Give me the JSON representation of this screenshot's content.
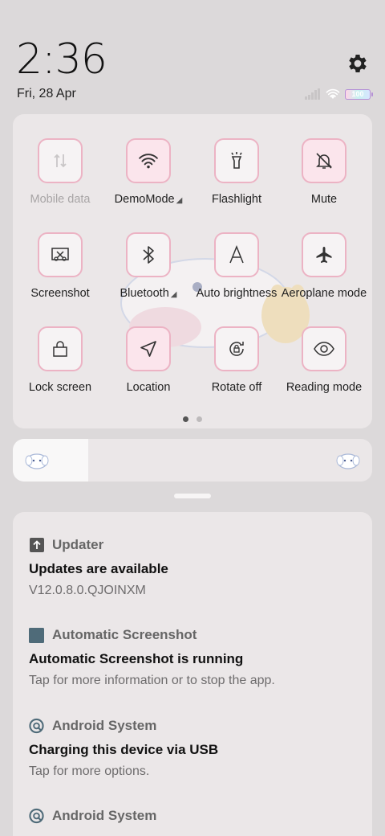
{
  "header": {
    "time": "2:36",
    "date": "Fri, 28 Apr",
    "battery": "100"
  },
  "quick_tiles": [
    {
      "label": "Mobile data",
      "icon": "mobile-data-icon",
      "active": false,
      "disabled": true,
      "has_arrow": false
    },
    {
      "label": "DemoMode",
      "icon": "wifi-icon",
      "active": true,
      "disabled": false,
      "has_arrow": true
    },
    {
      "label": "Flashlight",
      "icon": "flashlight-icon",
      "active": false,
      "disabled": false,
      "has_arrow": false
    },
    {
      "label": "Mute",
      "icon": "bell-off-icon",
      "active": true,
      "disabled": false,
      "has_arrow": false
    },
    {
      "label": "Screenshot",
      "icon": "screenshot-icon",
      "active": false,
      "disabled": false,
      "has_arrow": false
    },
    {
      "label": "Bluetooth",
      "icon": "bluetooth-icon",
      "active": false,
      "disabled": false,
      "has_arrow": true
    },
    {
      "label": "Auto brightness",
      "icon": "auto-brightness-icon",
      "active": false,
      "disabled": false,
      "has_arrow": false
    },
    {
      "label": "Aeroplane mode",
      "icon": "airplane-icon",
      "active": false,
      "disabled": false,
      "has_arrow": false
    },
    {
      "label": "Lock screen",
      "icon": "lock-icon",
      "active": false,
      "disabled": false,
      "has_arrow": false
    },
    {
      "label": "Location",
      "icon": "location-icon",
      "active": true,
      "disabled": false,
      "has_arrow": false
    },
    {
      "label": "Rotate off",
      "icon": "rotate-lock-icon",
      "active": false,
      "disabled": false,
      "has_arrow": false
    },
    {
      "label": "Reading mode",
      "icon": "eye-icon",
      "active": false,
      "disabled": false,
      "has_arrow": false
    }
  ],
  "pager": {
    "pages": 2,
    "current": 1
  },
  "brightness": {
    "level": 0.21
  },
  "notifications": [
    {
      "app": "Updater",
      "icon": "upload-arrow-icon",
      "title": "Updates are available",
      "body": "V12.0.8.0.QJOINXM"
    },
    {
      "app": "Automatic Screenshot",
      "icon": "app-square-icon",
      "title": "Automatic Screenshot is running",
      "body": "Tap for more information or to stop the app."
    },
    {
      "app": "Android System",
      "icon": "android-system-icon",
      "title": "Charging this device via USB",
      "body": "Tap for more options."
    },
    {
      "app": "Android System",
      "icon": "android-system-icon",
      "title": "",
      "body": ""
    }
  ],
  "colors": {
    "tile_border": "#ecb3c4",
    "tile_active": "#fbe5ec",
    "panel_bg": "#ebe7e8",
    "screen_bg": "#dcd9da"
  }
}
